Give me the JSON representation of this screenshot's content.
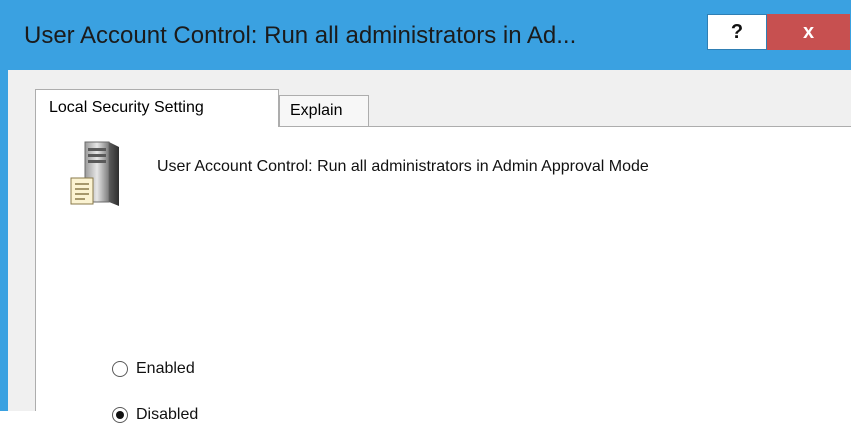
{
  "window": {
    "title": "User Account Control: Run all administrators in Ad...",
    "help_label": "?",
    "close_label": "x",
    "title_bar_color": "#3aa1e1",
    "close_color": "#c75050"
  },
  "tabs": [
    {
      "label": "Local Security Setting",
      "active": true
    },
    {
      "label": "Explain",
      "active": false
    }
  ],
  "policy": {
    "icon": "server-policy-icon",
    "name": "User Account Control: Run all administrators in Admin Approval Mode"
  },
  "options": [
    {
      "label": "Enabled",
      "selected": false
    },
    {
      "label": "Disabled",
      "selected": true
    }
  ]
}
